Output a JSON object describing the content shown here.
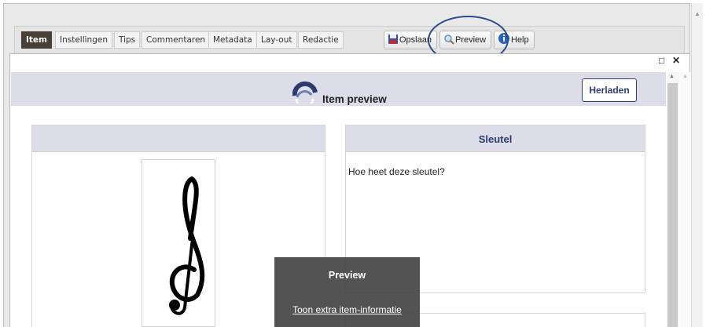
{
  "toolbar": {
    "tabs": [
      {
        "label": "Item",
        "active": true
      },
      {
        "label": "Instellingen"
      },
      {
        "label": "Tips"
      },
      {
        "label": "Commentaren"
      },
      {
        "label": "Metadata"
      },
      {
        "label": "Lay-out"
      },
      {
        "label": "Redactie"
      }
    ],
    "save_label": "Opslaan",
    "preview_label": "Preview",
    "help_label": "Help"
  },
  "modal": {
    "maximize_icon": "□",
    "close_icon": "✕"
  },
  "preview": {
    "title": "Item preview",
    "reload_label": "Herladen"
  },
  "left_panel": {
    "heading": "",
    "image_icon": "treble-clef-icon"
  },
  "right_panel": {
    "heading": "Sleutel",
    "question": "Hoe heet deze sleutel?"
  },
  "tooltip": {
    "title": "Preview",
    "link": "Toon extra item-informatie"
  },
  "colors": {
    "accent": "#2c3a6e",
    "active_tab": "#4a3f38",
    "header_bg": "#dcdde8",
    "highlight": "#2b4a8a"
  }
}
